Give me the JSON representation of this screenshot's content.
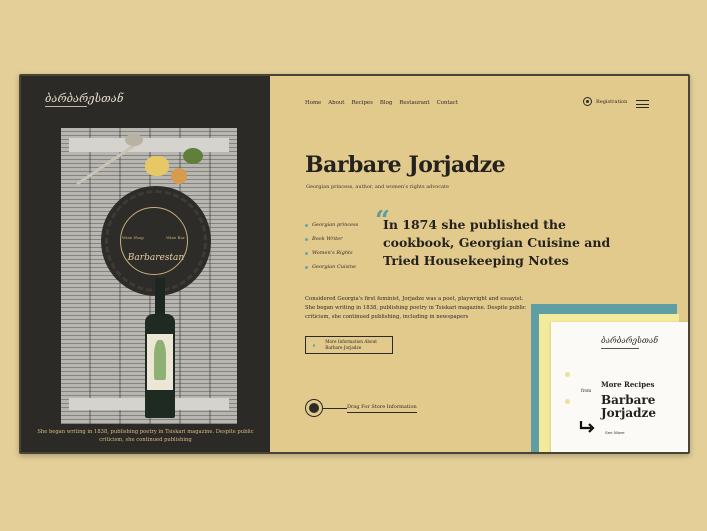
{
  "brand": {
    "logo_text": "ბარბარესთან"
  },
  "nav": {
    "items": [
      "Home",
      "About",
      "Recipes",
      "Blog",
      "Restaurant",
      "Contact"
    ],
    "registration_label": "Registration"
  },
  "hero": {
    "title": "Barbare Jorjadze",
    "subtitle": "Georgian princess, author, and women's rights advocate",
    "quote": "In 1874 she published the cookbook, Georgian Cuisine and Tried Housekeeping Notes",
    "tags": [
      "Georgian princess",
      "Book Writer",
      "Women's Rights",
      "Georgian Cuisine"
    ],
    "body": "Considered Georgia's first feminist, Jorjadze was a poet, playwright and essayist. She began writing in 1838, publishing poetry in Tsiskari magazine. Despite public criticism, she continued publishing, including in newspapers",
    "more_button": "More Information About Barbare Jorjadze",
    "drag_label": "Drag For Store Information"
  },
  "left_panel": {
    "caption": "She began writing in 1838, publishing poetry in Tsiskari magazine. Despite public criticism, she continued publishing",
    "plate_title": "Barbarestan",
    "plate_left": "Wine Shop",
    "plate_right": "Wine Bar"
  },
  "card": {
    "logo_text": "ბარბარესთან",
    "heading": "More Recipes",
    "from_label": "from",
    "name": "Barbare Jorjadze",
    "see_more": "See More"
  },
  "colors": {
    "accent_teal": "#5e9ea4",
    "background": "#e2c98c",
    "dark_panel": "#2b2a27",
    "yellow_card": "#f4ea9c"
  }
}
